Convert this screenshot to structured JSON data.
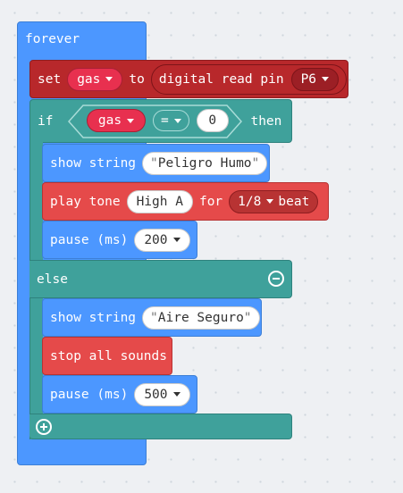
{
  "forever": {
    "label": "forever"
  },
  "set_block": {
    "set_label": "set",
    "variable": "gas",
    "to_label": "to",
    "reporter_label": "digital read pin",
    "pin": "P6"
  },
  "if_block": {
    "if_label": "if",
    "variable": "gas",
    "operator": "=",
    "compare_value": "0",
    "then_label": "then",
    "else_label": "else"
  },
  "then_branch": {
    "show_string_label": "show string",
    "show_string_value": "Peligro Humo",
    "play_tone_label": "play tone",
    "tone_value": "High A",
    "for_label": "for",
    "beat_value": "1/8",
    "beat_label": "beat",
    "pause_label": "pause (ms)",
    "pause_value": "200"
  },
  "else_branch": {
    "show_string_label": "show string",
    "show_string_value": "Aire Seguro",
    "stop_sounds_label": "stop all sounds",
    "pause_label": "pause (ms)",
    "pause_value": "500"
  },
  "colors": {
    "basic_blue": "#4c97ff",
    "logic_teal": "#3fa19b",
    "music_red": "#e54a4a",
    "pins_red": "#b8282b",
    "variable_pink": "#e8304f",
    "workspace": "#eef0f3"
  }
}
